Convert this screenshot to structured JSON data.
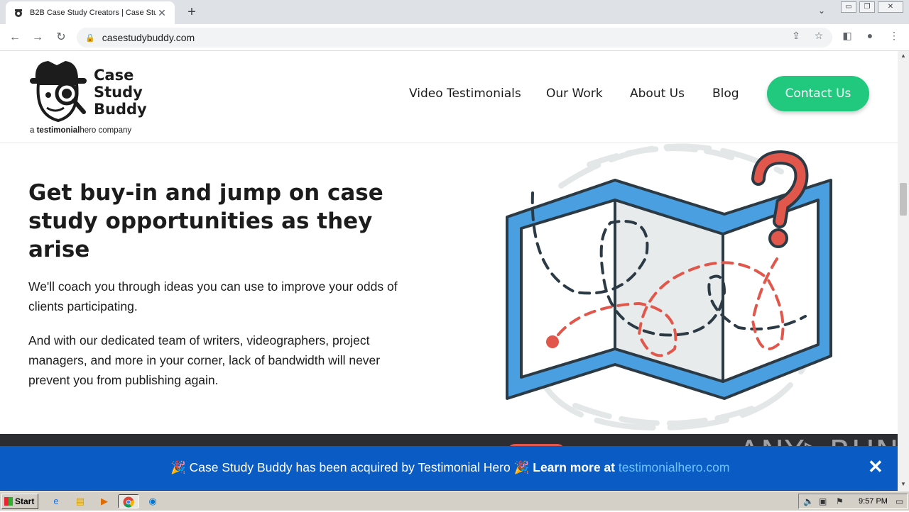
{
  "browser": {
    "tab_title": "B2B Case Study Creators | Case Stu",
    "new_tab": "+",
    "tab_close": "✕",
    "url": "casestudybuddy.com",
    "window_controls": [
      "▭",
      "❐",
      "✕"
    ]
  },
  "logo": {
    "brand_line1": "Case",
    "brand_line2": "Study",
    "brand_line3": "Buddy",
    "tag_prefix": "a ",
    "tag_bold": "testimonial",
    "tag_rest": "hero company"
  },
  "nav": {
    "items": [
      "Video Testimonials",
      "Our Work",
      "About Us",
      "Blog"
    ],
    "cta": "Contact Us"
  },
  "hero": {
    "heading": "Get buy-in and jump on case study opportunities as they arise",
    "para1": "We'll coach you through ideas you can use to improve your odds of clients participating.",
    "para2": "And with our dedicated team of writers, videographers, project managers, and more in your corner, lack of bandwidth will never prevent you from publishing again."
  },
  "banner": {
    "emoji": "🎉",
    "text": "Case Study Buddy has been acquired by Testimonial Hero",
    "learn": "Learn more at",
    "link": "testimonialhero.com",
    "close": "✕"
  },
  "watermark": "ANY▷RUN",
  "taskbar": {
    "start": "Start",
    "time": "9:57 PM"
  },
  "colors": {
    "accent_green": "#21c97f",
    "banner_blue": "#0a5bc4",
    "map_blue": "#4a9fe0",
    "path_red": "#e2574c"
  }
}
